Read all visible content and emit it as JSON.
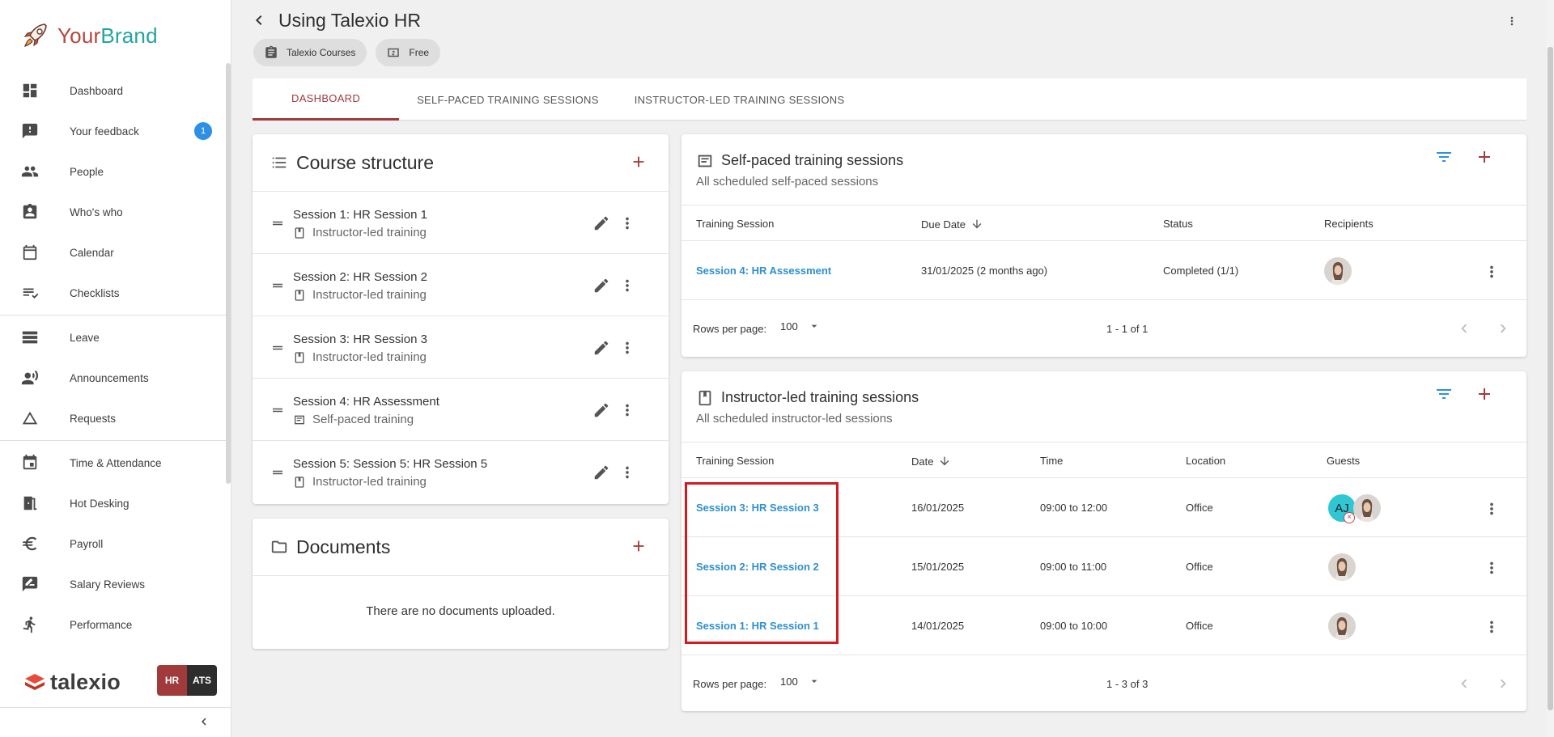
{
  "brand": {
    "your": "Your",
    "brand": "Brand"
  },
  "sidebar": {
    "items": [
      {
        "label": "Dashboard",
        "icon": "dashboard-icon"
      },
      {
        "label": "Your feedback",
        "icon": "feedback-icon",
        "badge": "1"
      },
      {
        "label": "People",
        "icon": "people-icon"
      },
      {
        "label": "Who's who",
        "icon": "contact-card-icon"
      },
      {
        "label": "Calendar",
        "icon": "calendar-icon"
      },
      {
        "label": "Checklists",
        "icon": "checklist-icon"
      },
      {
        "label": "Leave",
        "icon": "leave-icon"
      },
      {
        "label": "Announcements",
        "icon": "announcement-icon"
      },
      {
        "label": "Requests",
        "icon": "triangle-icon"
      },
      {
        "label": "Time & Attendance",
        "icon": "calendar-event-icon"
      },
      {
        "label": "Hot Desking",
        "icon": "door-icon"
      },
      {
        "label": "Payroll",
        "icon": "euro-icon"
      },
      {
        "label": "Salary Reviews",
        "icon": "rate-review-icon"
      },
      {
        "label": "Performance",
        "icon": "run-icon"
      }
    ],
    "footer": {
      "logo_text": "talexio",
      "hr": "HR",
      "ats": "ATS"
    }
  },
  "header": {
    "title": "Using Talexio HR",
    "chips": [
      {
        "label": "Talexio Courses"
      },
      {
        "label": "Free"
      }
    ]
  },
  "tabs": [
    {
      "label": "DASHBOARD",
      "active": true
    },
    {
      "label": "SELF-PACED TRAINING SESSIONS",
      "active": false
    },
    {
      "label": "INSTRUCTOR-LED TRAINING SESSIONS",
      "active": false
    }
  ],
  "course_structure": {
    "title": "Course structure",
    "items": [
      {
        "name": "Session 1: HR Session 1",
        "type": "Instructor-led training"
      },
      {
        "name": "Session 2: HR Session 2",
        "type": "Instructor-led training"
      },
      {
        "name": "Session 3: HR Session 3",
        "type": "Instructor-led training"
      },
      {
        "name": "Session 4: HR Assessment",
        "type": "Self-paced training"
      },
      {
        "name": "Session 5: Session 5: HR Session 5",
        "type": "Instructor-led training"
      }
    ]
  },
  "documents": {
    "title": "Documents",
    "empty": "There are no documents uploaded."
  },
  "self_paced": {
    "title": "Self-paced training sessions",
    "subtitle": "All scheduled self-paced sessions",
    "columns": {
      "session": "Training Session",
      "due": "Due Date",
      "status": "Status",
      "recipients": "Recipients"
    },
    "rows": [
      {
        "session": "Session 4: HR Assessment",
        "due": "31/01/2025 (2 months ago)",
        "status": "Completed (1/1)"
      }
    ],
    "footer": {
      "rpp_label": "Rows per page:",
      "rpp_value": "100",
      "range": "1 - 1 of 1"
    }
  },
  "instructor_led": {
    "title": "Instructor-led training sessions",
    "subtitle": "All scheduled instructor-led sessions",
    "columns": {
      "session": "Training Session",
      "date": "Date",
      "time": "Time",
      "location": "Location",
      "guests": "Guests"
    },
    "rows": [
      {
        "session": "Session 3: HR Session 3",
        "date": "16/01/2025",
        "time": "09:00 to 12:00",
        "location": "Office",
        "guest_initials": "AJ"
      },
      {
        "session": "Session 2: HR Session 2",
        "date": "15/01/2025",
        "time": "09:00 to 11:00",
        "location": "Office"
      },
      {
        "session": "Session 1: HR Session 1",
        "date": "14/01/2025",
        "time": "09:00 to 10:00",
        "location": "Office"
      }
    ],
    "footer": {
      "rpp_label": "Rows per page:",
      "rpp_value": "100",
      "range": "1 - 3 of 3"
    }
  },
  "colors": {
    "accent": "#a13a3a",
    "link": "#2d8fd0",
    "badge": "#2d8fe6",
    "highlight": "#d6191d"
  }
}
